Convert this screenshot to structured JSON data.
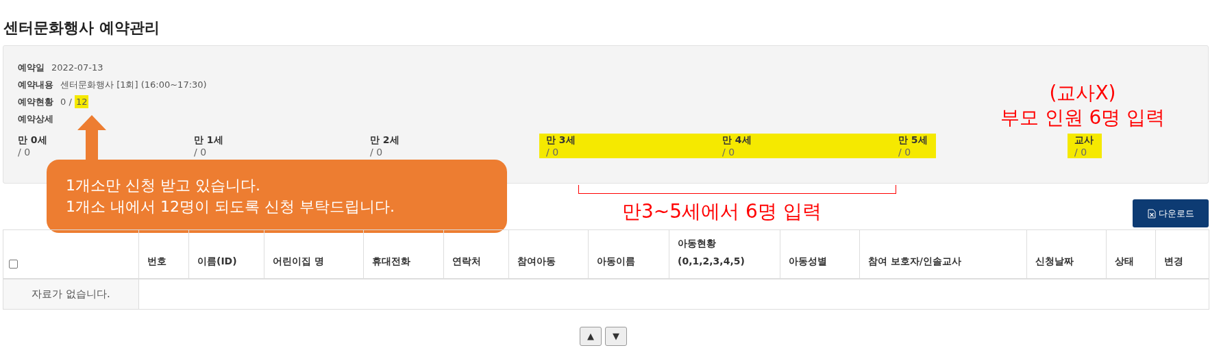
{
  "page_title": "센터문화행사 예약관리",
  "info": [
    {
      "label": "예약일",
      "value": "2022-07-13"
    },
    {
      "label": "예약내용",
      "value": "센터문화행사 [1회] (16:00~17:30)"
    },
    {
      "label": "예약현황",
      "value": "0 / ",
      "highlight": "12"
    },
    {
      "label": "예약상세"
    }
  ],
  "age_groups": [
    {
      "label": "만 0세",
      "count": "/ 0",
      "highlighted": false
    },
    {
      "label": "만 1세",
      "count": "/ 0",
      "highlighted": false
    },
    {
      "label": "만 2세",
      "count": "/ 0",
      "highlighted": false
    },
    {
      "label": "만 3세",
      "count": "/ 0",
      "highlighted": true
    },
    {
      "label": "만 4세",
      "count": "/ 0",
      "highlighted": true
    },
    {
      "label": "만 5세",
      "count": "/ 0",
      "highlighted": true
    },
    {
      "label": "교사",
      "count": "/ 0",
      "highlighted": true
    }
  ],
  "callout": {
    "lines": [
      "1개소만 신청 받고 있습니다.",
      "1개소 내에서 12명이 되도록 신청 부탁드립니다."
    ]
  },
  "note_teacher": [
    "(교사X)",
    "부모 인원 6명 입력"
  ],
  "note_ages": "만3~5세에서 6명 입력",
  "download_button": "다운로드",
  "table": {
    "select_all_checked": false,
    "columns": [
      "번호",
      "이름(ID)",
      "어린이집 명",
      "휴대전화",
      "연락처",
      "참여아동",
      "아동이름",
      "아동현황\n(0,1,2,3,4,5)",
      "아동성별",
      "참여 보호자/인솔교사",
      "신청날짜",
      "상태",
      "변경"
    ],
    "empty_message": "자료가 없습니다."
  },
  "pager": [
    "▲",
    "▼"
  ]
}
